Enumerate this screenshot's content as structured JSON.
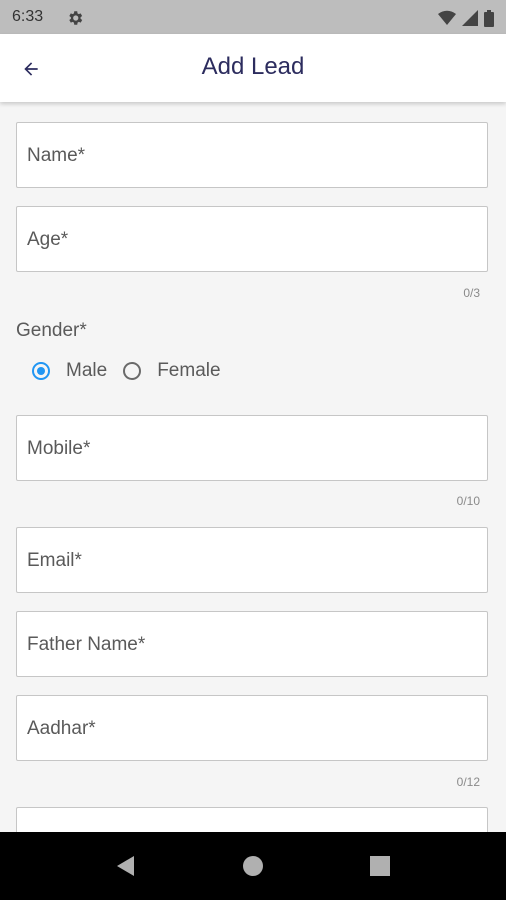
{
  "status_bar": {
    "time": "6:33",
    "icons": [
      "settings-icon",
      "wifi-icon",
      "signal-icon",
      "battery-icon"
    ]
  },
  "app_bar": {
    "title": "Add Lead",
    "back_icon": "arrow-back-icon"
  },
  "form": {
    "name": {
      "label": "Name*"
    },
    "age": {
      "label": "Age*",
      "counter": "0/3"
    },
    "gender": {
      "label": "Gender*",
      "options": [
        "Male",
        "Female"
      ],
      "selected": "Male"
    },
    "mobile": {
      "label": "Mobile*",
      "counter": "0/10"
    },
    "email": {
      "label": "Email*"
    },
    "father_name": {
      "label": "Father Name*"
    },
    "aadhar": {
      "label": "Aadhar*",
      "counter": "0/12"
    }
  },
  "colors": {
    "accent": "#2196f3",
    "title": "#2c2c5e",
    "status_bar": "#bdbdbd",
    "nav_bar": "#000000"
  },
  "nav_bar": {
    "icons": [
      "back-triangle-icon",
      "home-circle-icon",
      "recents-square-icon"
    ]
  }
}
